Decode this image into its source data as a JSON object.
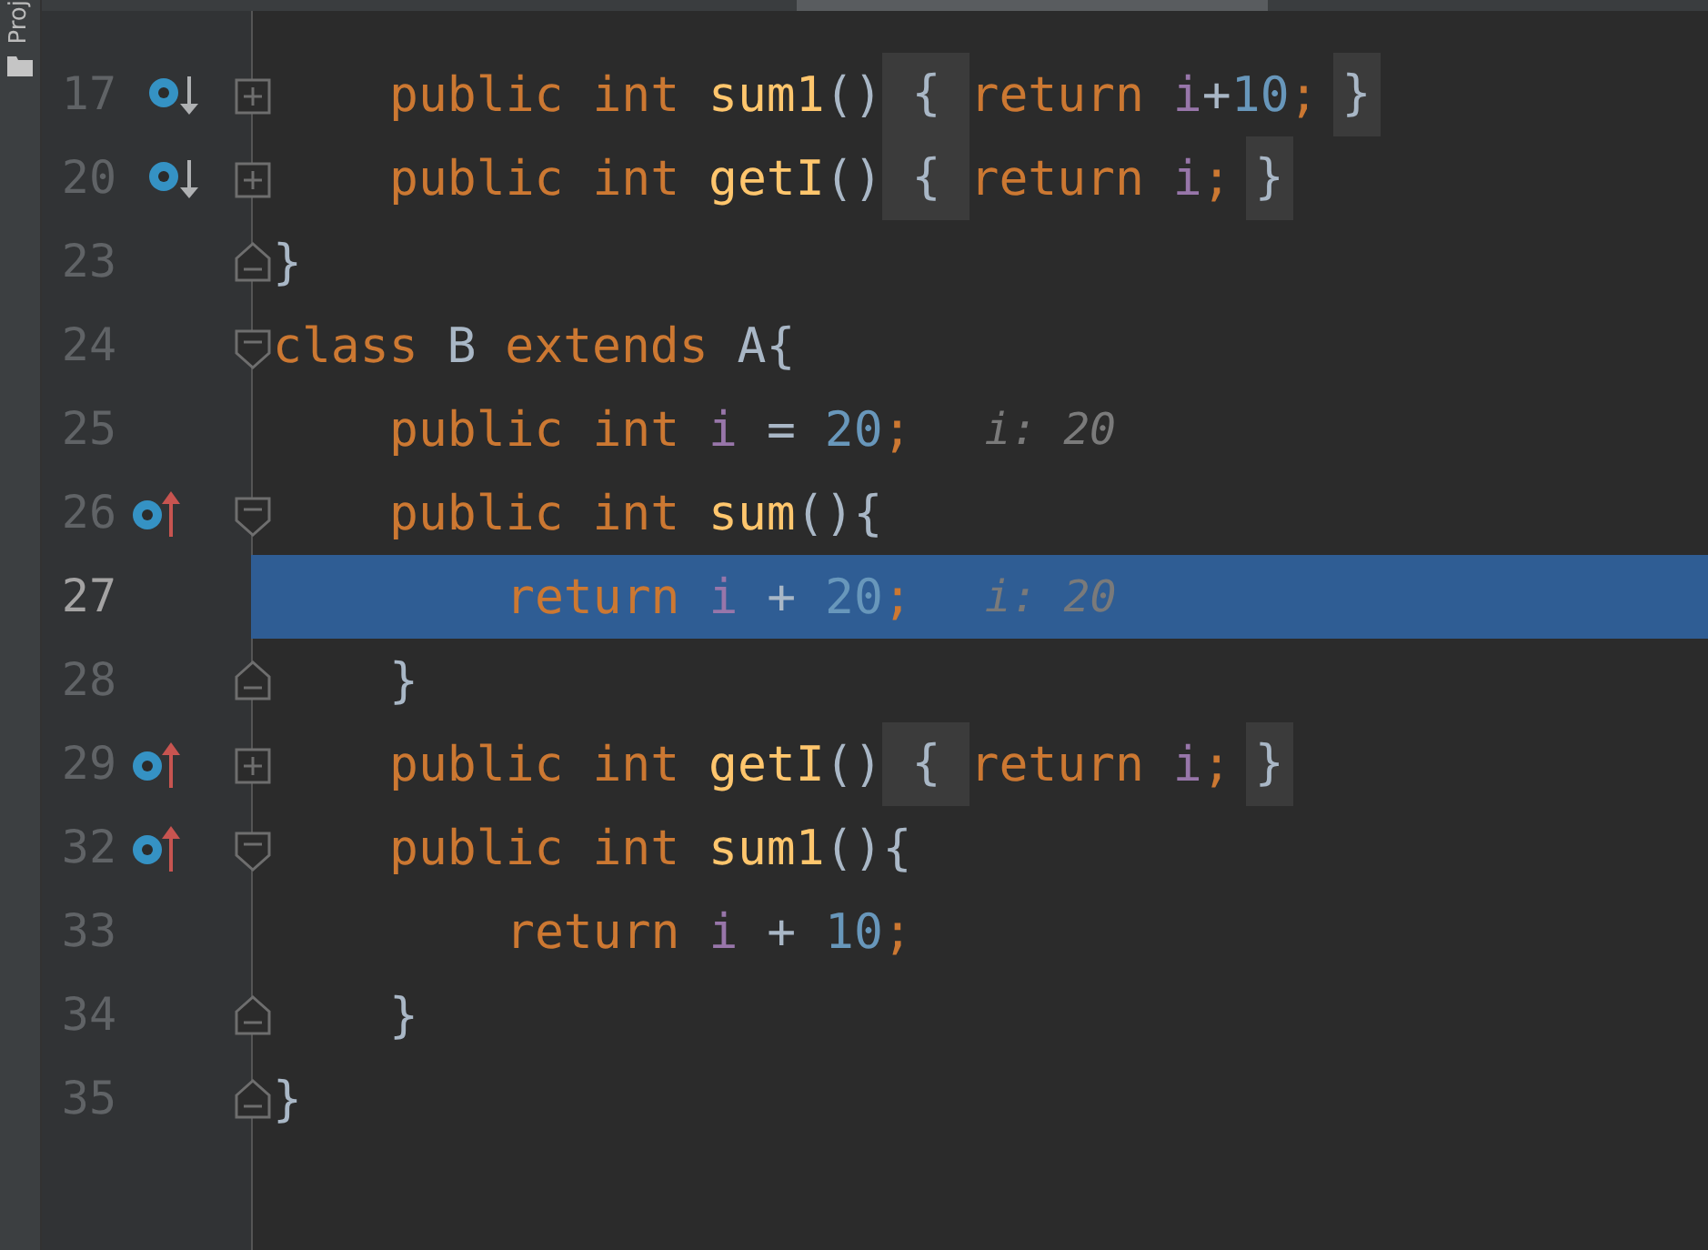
{
  "side_tab": {
    "label": "Proj"
  },
  "lines": [
    {
      "number": "17",
      "kind": "member",
      "implemented": true,
      "overrides": false,
      "collapsed": true,
      "fold_start": false,
      "fold_end": false,
      "selected": false,
      "tokens": [
        {
          "kind": "keyword",
          "text": "public "
        },
        {
          "kind": "keyword",
          "text": "int "
        },
        {
          "kind": "method",
          "text": "sum1"
        },
        {
          "kind": "plain",
          "text": "()"
        },
        {
          "kind": "fold",
          "text": "{"
        },
        {
          "kind": "keyword",
          "text": "return "
        },
        {
          "kind": "field",
          "text": "i"
        },
        {
          "kind": "plain",
          "text": "+"
        },
        {
          "kind": "number",
          "text": "10"
        },
        {
          "kind": "keyword",
          "text": ";"
        },
        {
          "kind": "foldend",
          "text": "}"
        }
      ]
    },
    {
      "number": "20",
      "kind": "member",
      "implemented": true,
      "overrides": false,
      "collapsed": true,
      "fold_start": false,
      "fold_end": false,
      "selected": false,
      "tokens": [
        {
          "kind": "keyword",
          "text": "public "
        },
        {
          "kind": "keyword",
          "text": "int "
        },
        {
          "kind": "method",
          "text": "getI"
        },
        {
          "kind": "plain",
          "text": "()"
        },
        {
          "kind": "fold",
          "text": "{"
        },
        {
          "kind": "keyword",
          "text": "return "
        },
        {
          "kind": "field",
          "text": "i"
        },
        {
          "kind": "keyword",
          "text": ";"
        },
        {
          "kind": "foldend",
          "text": "}"
        }
      ]
    },
    {
      "number": "23",
      "kind": "top",
      "implemented": false,
      "overrides": false,
      "collapsed": false,
      "fold_start": false,
      "fold_end": true,
      "selected": false,
      "tokens": [
        {
          "kind": "plain",
          "text": "}"
        }
      ]
    },
    {
      "number": "24",
      "kind": "top",
      "implemented": false,
      "overrides": false,
      "collapsed": false,
      "fold_start": true,
      "fold_end": false,
      "selected": false,
      "tokens": [
        {
          "kind": "keyword",
          "text": "class "
        },
        {
          "kind": "plain",
          "text": "B "
        },
        {
          "kind": "keyword",
          "text": "extends "
        },
        {
          "kind": "plain",
          "text": "A{"
        }
      ]
    },
    {
      "number": "25",
      "kind": "member",
      "implemented": false,
      "overrides": false,
      "collapsed": false,
      "fold_start": false,
      "fold_end": false,
      "selected": false,
      "tokens": [
        {
          "kind": "keyword",
          "text": "public "
        },
        {
          "kind": "keyword",
          "text": "int "
        },
        {
          "kind": "field",
          "text": "i"
        },
        {
          "kind": "plain",
          "text": " = "
        },
        {
          "kind": "number",
          "text": "20"
        },
        {
          "kind": "keyword",
          "text": ";"
        },
        {
          "kind": "hint",
          "text": "i: 20"
        }
      ]
    },
    {
      "number": "26",
      "kind": "member",
      "implemented": false,
      "overrides": true,
      "collapsed": false,
      "fold_start": true,
      "fold_end": false,
      "selected": false,
      "tokens": [
        {
          "kind": "keyword",
          "text": "public "
        },
        {
          "kind": "keyword",
          "text": "int "
        },
        {
          "kind": "method",
          "text": "sum"
        },
        {
          "kind": "plain",
          "text": "(){"
        }
      ]
    },
    {
      "number": "27",
      "kind": "body",
      "implemented": false,
      "overrides": false,
      "collapsed": false,
      "fold_start": false,
      "fold_end": false,
      "selected": true,
      "tokens": [
        {
          "kind": "keyword",
          "text": "return "
        },
        {
          "kind": "field",
          "text": "i"
        },
        {
          "kind": "plain",
          "text": " + "
        },
        {
          "kind": "number",
          "text": "20"
        },
        {
          "kind": "keyword",
          "text": ";"
        },
        {
          "kind": "hint",
          "text": "i: 20"
        }
      ]
    },
    {
      "number": "28",
      "kind": "member",
      "implemented": false,
      "overrides": false,
      "collapsed": false,
      "fold_start": false,
      "fold_end": true,
      "selected": false,
      "tokens": [
        {
          "kind": "plain",
          "text": "}"
        }
      ]
    },
    {
      "number": "29",
      "kind": "member",
      "implemented": false,
      "overrides": true,
      "collapsed": true,
      "fold_start": false,
      "fold_end": false,
      "selected": false,
      "tokens": [
        {
          "kind": "keyword",
          "text": "public "
        },
        {
          "kind": "keyword",
          "text": "int "
        },
        {
          "kind": "method",
          "text": "getI"
        },
        {
          "kind": "plain",
          "text": "()"
        },
        {
          "kind": "fold",
          "text": "{"
        },
        {
          "kind": "keyword",
          "text": "return "
        },
        {
          "kind": "field",
          "text": "i"
        },
        {
          "kind": "keyword",
          "text": ";"
        },
        {
          "kind": "foldend",
          "text": "}"
        }
      ]
    },
    {
      "number": "32",
      "kind": "member",
      "implemented": false,
      "overrides": true,
      "collapsed": false,
      "fold_start": true,
      "fold_end": false,
      "selected": false,
      "tokens": [
        {
          "kind": "keyword",
          "text": "public "
        },
        {
          "kind": "keyword",
          "text": "int "
        },
        {
          "kind": "method",
          "text": "sum1"
        },
        {
          "kind": "plain",
          "text": "(){"
        }
      ]
    },
    {
      "number": "33",
      "kind": "body",
      "implemented": false,
      "overrides": false,
      "collapsed": false,
      "fold_start": false,
      "fold_end": false,
      "selected": false,
      "tokens": [
        {
          "kind": "keyword",
          "text": "return "
        },
        {
          "kind": "field",
          "text": "i"
        },
        {
          "kind": "plain",
          "text": " + "
        },
        {
          "kind": "number",
          "text": "10"
        },
        {
          "kind": "keyword",
          "text": ";"
        }
      ]
    },
    {
      "number": "34",
      "kind": "member",
      "implemented": false,
      "overrides": false,
      "collapsed": false,
      "fold_start": false,
      "fold_end": true,
      "selected": false,
      "tokens": [
        {
          "kind": "plain",
          "text": "}"
        }
      ]
    },
    {
      "number": "35",
      "kind": "top",
      "implemented": false,
      "overrides": false,
      "collapsed": false,
      "fold_start": false,
      "fold_end": true,
      "selected": false,
      "tokens": [
        {
          "kind": "plain",
          "text": "}"
        }
      ]
    }
  ]
}
